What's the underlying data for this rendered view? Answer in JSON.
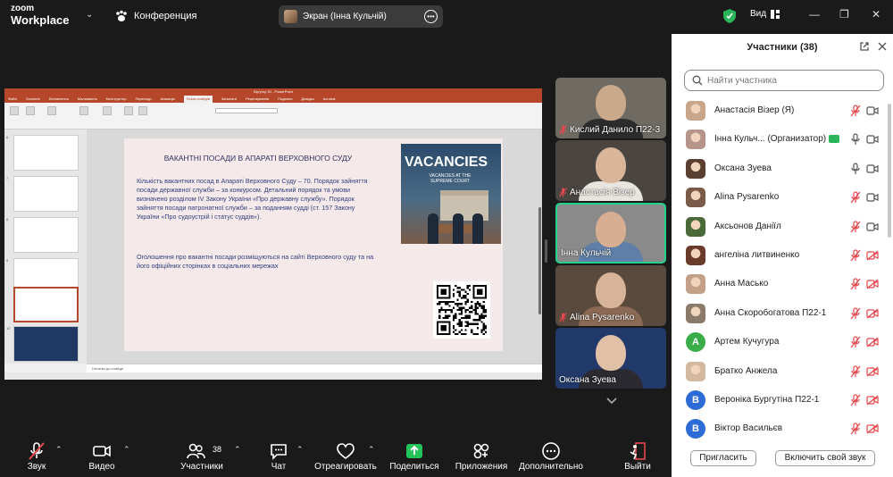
{
  "topbar": {
    "logo_line1": "zoom",
    "logo_line2": "Workplace",
    "meeting_label": "Конференция",
    "screen_label": "Экран (Інна Кульчій)",
    "view_label": "Вид",
    "accent_green": "#23d18b"
  },
  "slide": {
    "title": "ВАКАНТНІ ПОСАДИ В АПАРАТІ ВЕРХОВНОГО СУДУ",
    "body": "Кількість вакантних посад в Апараті Верховного Суду – 70. Порядок зайняття посади державної служби – за конкурсом. Детальний порядок та умови визначено розділом IV Закону України «Про державну службу». Порядок зайняття посади патронатної служби – за поданням судді (ст. 157 Закону України «Про судоустрій і статус суддів»).",
    "body2": "Оголошення про вакантні посади розміщуються на сайті Верховного суду та на його офіційних сторінках в соціальних мережах",
    "image_title": "VACANCIES",
    "image_subtitle": "VACANCIES AT THE SUPREME COURT",
    "notes_placeholder": "Нотатки до слайда"
  },
  "powerpoint": {
    "window_title": "Вір'утку 30 - PowerPoint",
    "tabs": [
      "Файл",
      "Основне",
      "Вставлення",
      "Малювання",
      "Конструктор",
      "Переходи",
      "Анімація",
      "Показ слайдів",
      "Записати",
      "Рецензування",
      "Подання",
      "Довідка",
      "Acrobat"
    ],
    "active_tab": "Показ слайдів",
    "thumb_numbers": [
      "6",
      "7",
      "8",
      "9",
      "10"
    ]
  },
  "tiles": [
    {
      "name": "Кислий Данило П22-3",
      "muted": true,
      "face": "#c9a98a",
      "body": "#2c2c2c",
      "bg": "#6f6a62"
    },
    {
      "name": "Анастасія Візер",
      "muted": true,
      "face": "#d9b59a",
      "body": "#e8e4de",
      "bg": "#4a4540"
    },
    {
      "name": "Інна Кульчій",
      "muted": false,
      "face": "#d8ae92",
      "body": "#5f7fa8",
      "bg": "#8a8a8a"
    },
    {
      "name": "Alina Pysarenko",
      "muted": true,
      "face": "#d6b399",
      "body": "#8b6a55",
      "bg": "#5a4a3e"
    },
    {
      "name": "Оксана Зуева",
      "muted": false,
      "face": "#e0c0a6",
      "body": "#2a2a30",
      "bg": "#213a6a"
    }
  ],
  "toolbar": {
    "audio": "Звук",
    "video": "Видео",
    "participants": "Участники",
    "participants_count": "38",
    "chat": "Чат",
    "react": "Отреагировать",
    "share": "Поделиться",
    "apps": "Приложения",
    "more": "Дополнительно",
    "leave": "Выйти"
  },
  "panel": {
    "title": "Участники (38)",
    "search_placeholder": "Найти участника",
    "invite_button": "Пригласить",
    "unmute_button": "Включить свой звук",
    "participants": [
      {
        "name": "Анастасія Візер (Я)",
        "avatar": "photo",
        "color": "#c9a58a",
        "mic": "muted",
        "cam": "on"
      },
      {
        "name": "Інна Кульч... (Организатор)",
        "avatar": "photo",
        "color": "#b8958a",
        "mic": "on",
        "cam": "on",
        "tag": true
      },
      {
        "name": "Оксана Зуева",
        "avatar": "photo",
        "color": "#5a4030",
        "mic": "on",
        "cam": "on"
      },
      {
        "name": "Alina Pysarenko",
        "avatar": "photo",
        "color": "#7a5a48",
        "mic": "muted",
        "cam": "on"
      },
      {
        "name": "Аксьонов Даніїл",
        "avatar": "photo",
        "color": "#4a6a3a",
        "mic": "muted",
        "cam": "on"
      },
      {
        "name": "ангеліна литвиненко",
        "avatar": "photo",
        "color": "#6a3a2a",
        "mic": "muted",
        "cam": "off"
      },
      {
        "name": "Анна Масько",
        "avatar": "photo",
        "color": "#c4a088",
        "mic": "muted",
        "cam": "off"
      },
      {
        "name": "Анна Скоробогатова П22-1",
        "avatar": "photo",
        "color": "#8a7a6a",
        "mic": "muted",
        "cam": "off"
      },
      {
        "name": "Артем Кучугура",
        "avatar": "letter",
        "letter": "A",
        "color": "#3aad4a",
        "mic": "muted",
        "cam": "off"
      },
      {
        "name": "Братко Анжела",
        "avatar": "photo",
        "color": "#d4b8a0",
        "mic": "muted",
        "cam": "off"
      },
      {
        "name": "Вероніка Бургутіна П22-1",
        "avatar": "letter",
        "letter": "B",
        "color": "#2d6bd6",
        "mic": "muted",
        "cam": "off"
      },
      {
        "name": "Віктор Васильєв",
        "avatar": "letter",
        "letter": "B",
        "color": "#2d6bd6",
        "mic": "muted",
        "cam": "off"
      }
    ]
  }
}
